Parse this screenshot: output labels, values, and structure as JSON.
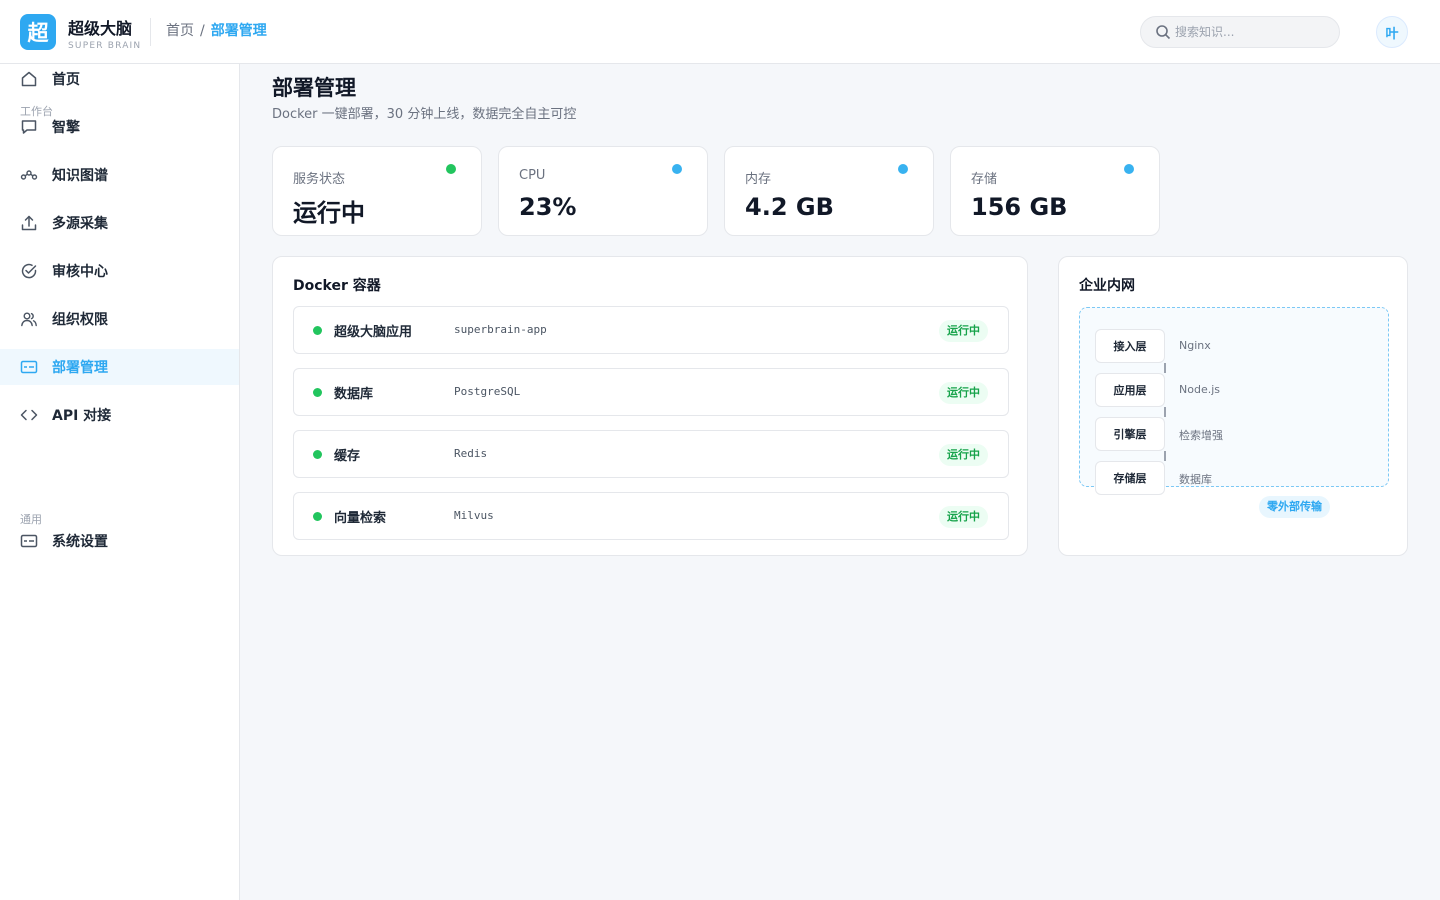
{
  "brand": {
    "logo_char": "超",
    "name": "超级大脑",
    "sub": "SUPER BRAIN"
  },
  "breadcrumb": {
    "home": "首页",
    "separator": "/",
    "current": "部署管理"
  },
  "search": {
    "placeholder": "搜索知识..."
  },
  "user": {
    "avatar_char": "叶"
  },
  "sidebar": {
    "section_workbench": "工作台",
    "section_general": "通用",
    "items": [
      {
        "label": "首页",
        "icon": "home-icon"
      },
      {
        "label": "智擎",
        "icon": "chat-icon"
      },
      {
        "label": "知识图谱",
        "icon": "graph-icon"
      },
      {
        "label": "多源采集",
        "icon": "upload-icon"
      },
      {
        "label": "审核中心",
        "icon": "check-circle-icon"
      },
      {
        "label": "组织权限",
        "icon": "users-icon"
      },
      {
        "label": "部署管理",
        "icon": "deploy-icon",
        "active": true
      },
      {
        "label": "API 对接",
        "icon": "code-icon"
      },
      {
        "label": "系统设置",
        "icon": "settings-icon"
      }
    ]
  },
  "page": {
    "title": "部署管理",
    "subtitle": "Docker 一键部署，30 分钟上线，数据完全自主可控"
  },
  "stats": [
    {
      "label": "服务状态",
      "value": "运行中",
      "dot_color": "#22c55e"
    },
    {
      "label": "CPU",
      "value": "23%",
      "dot_color": "#38b2f0"
    },
    {
      "label": "内存",
      "value": "4.2 GB",
      "dot_color": "#38b2f0"
    },
    {
      "label": "存储",
      "value": "156 GB",
      "dot_color": "#38b2f0"
    }
  ],
  "docker": {
    "title": "Docker 容器",
    "containers": [
      {
        "name": "超级大脑应用",
        "image": "superbrain-app",
        "status": "运行中"
      },
      {
        "name": "数据库",
        "image": "PostgreSQL",
        "status": "运行中"
      },
      {
        "name": "缓存",
        "image": "Redis",
        "status": "运行中"
      },
      {
        "name": "向量检索",
        "image": "Milvus",
        "status": "运行中"
      }
    ]
  },
  "network": {
    "title": "企业内网",
    "layers": [
      {
        "name": "接入层",
        "desc": "Nginx"
      },
      {
        "name": "应用层",
        "desc": "Node.js"
      },
      {
        "name": "引擎层",
        "desc": "检索增强"
      },
      {
        "name": "存储层",
        "desc": "数据库"
      }
    ],
    "badge": "零外部传输"
  },
  "colors": {
    "accent": "#2ea8f1",
    "success": "#22c55e",
    "info": "#38b2f0"
  }
}
